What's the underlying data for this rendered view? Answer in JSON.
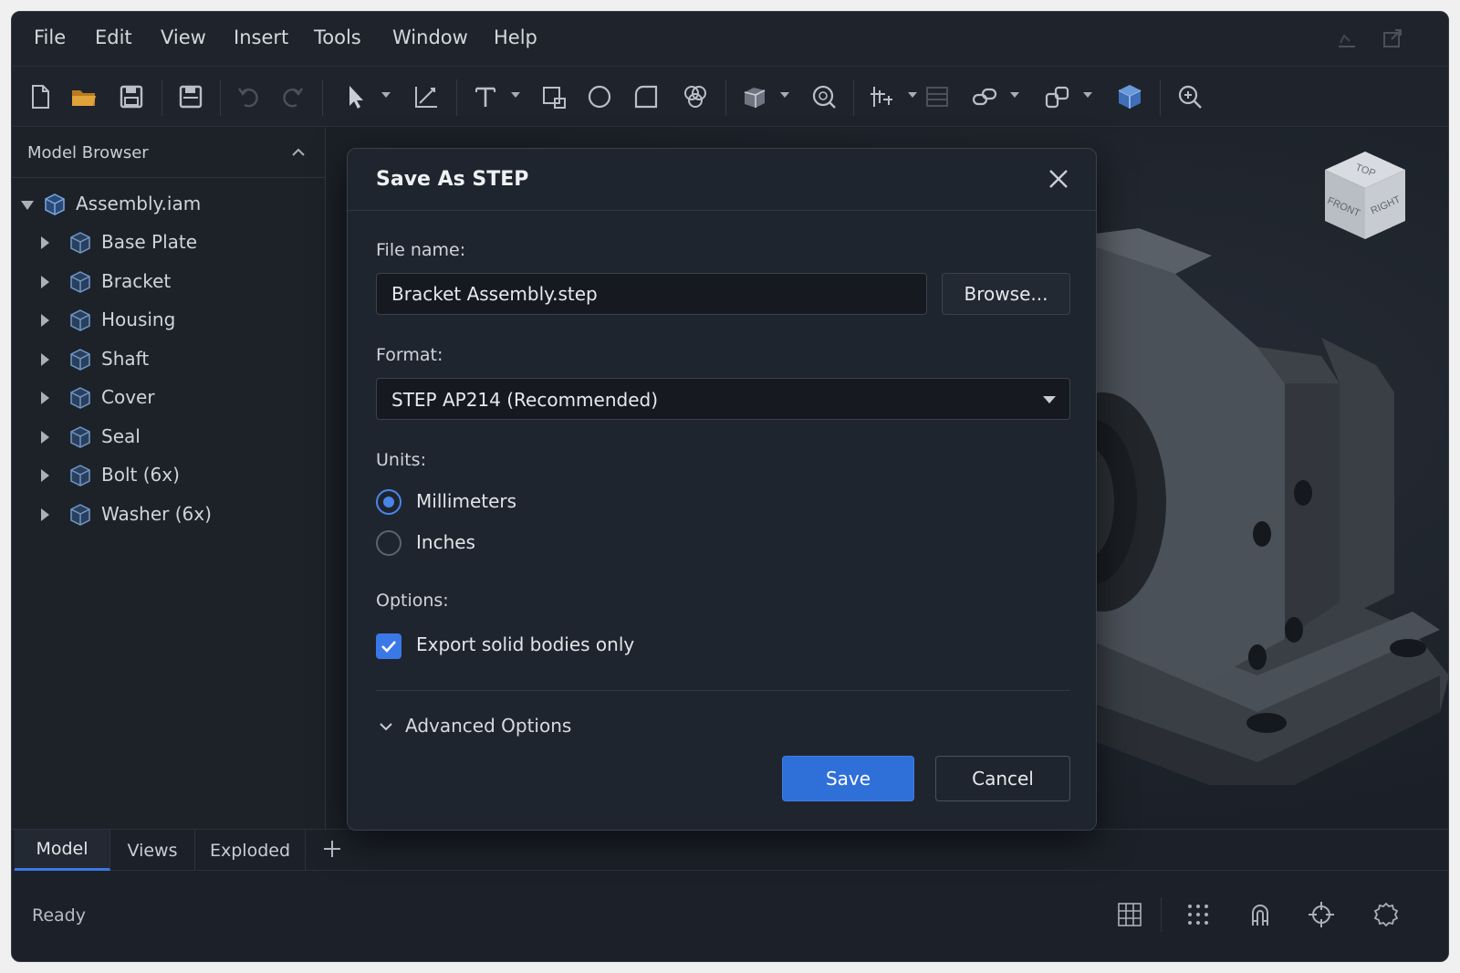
{
  "menubar": {
    "items": [
      "File",
      "Edit",
      "View",
      "Insert",
      "Tools",
      "Window",
      "Help"
    ]
  },
  "toolbar": {
    "icons": [
      "new-file-icon",
      "open-folder-icon",
      "save-icon",
      "save-as-icon",
      "undo-icon",
      "redo-icon",
      "select-arrow-icon",
      "sketch-icon",
      "text-icon",
      "rectangle-tool-icon",
      "circle-tool-icon",
      "fillet-icon",
      "pattern-icon",
      "extrude-icon",
      "inspect-icon",
      "constraint-icon",
      "layers-icon",
      "link-icon",
      "assemble-icon",
      "3d-box-icon",
      "zoom-icon"
    ]
  },
  "sidebar": {
    "title": "Model Browser",
    "root": "Assembly.iam",
    "items": [
      {
        "label": "Base Plate"
      },
      {
        "label": "Bracket"
      },
      {
        "label": "Housing"
      },
      {
        "label": "Shaft"
      },
      {
        "label": "Cover"
      },
      {
        "label": "Seal"
      },
      {
        "label": "Bolt (6x)"
      },
      {
        "label": "Washer (6x)"
      }
    ]
  },
  "viewcube": {
    "top": "TOP",
    "front": "FRONT",
    "right": "RIGHT"
  },
  "dialog": {
    "title": "Save As STEP",
    "file_name_label": "File name:",
    "file_name_value": "Bracket Assembly.step",
    "browse_label": "Browse...",
    "format_label": "Format:",
    "format_value": "STEP AP214 (Recommended)",
    "units_label": "Units:",
    "units": [
      {
        "label": "Millimeters",
        "selected": true
      },
      {
        "label": "Inches",
        "selected": false
      }
    ],
    "options_label": "Options:",
    "export_solid_label": "Export solid bodies only",
    "export_solid_checked": true,
    "advanced_label": "Advanced Options",
    "save_label": "Save",
    "cancel_label": "Cancel"
  },
  "tabs": [
    {
      "label": "Model",
      "active": true
    },
    {
      "label": "Views",
      "active": false
    },
    {
      "label": "Exploded",
      "active": false
    }
  ],
  "status": {
    "text": "Ready"
  },
  "colors": {
    "accent": "#3b78e7",
    "background": "#1c2129",
    "panel": "#1f252e"
  }
}
